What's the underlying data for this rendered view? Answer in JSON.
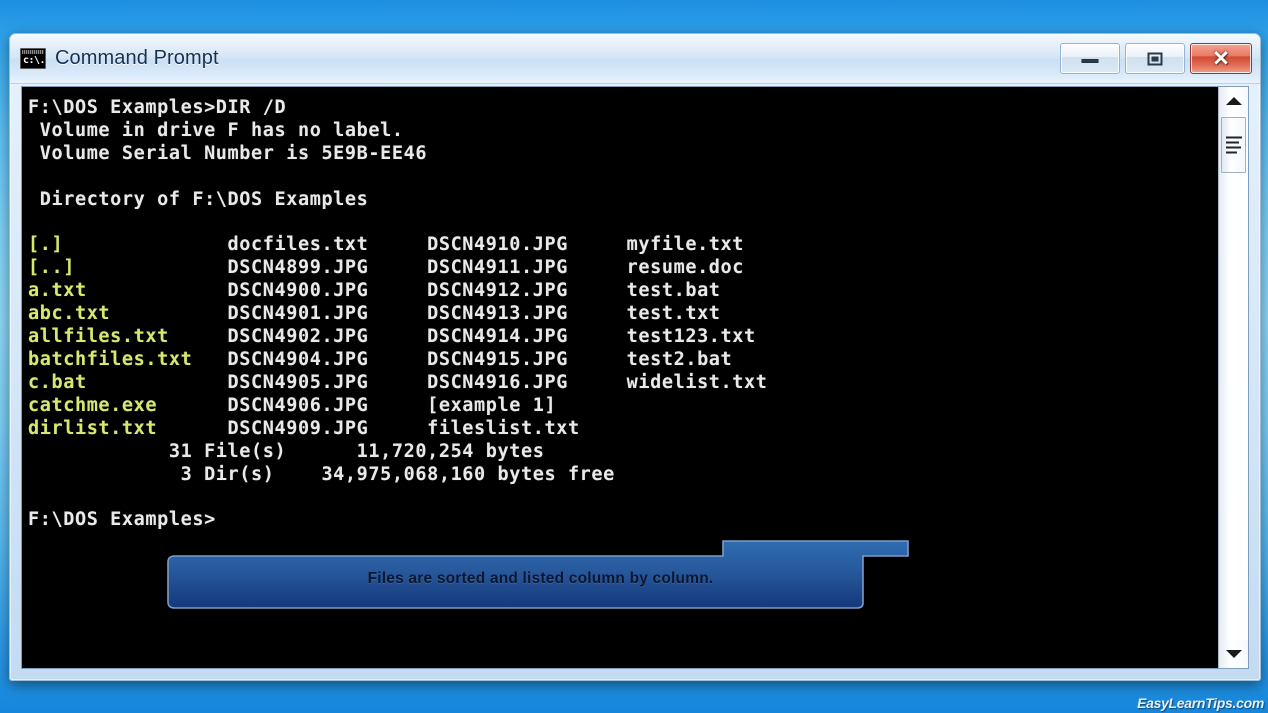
{
  "desktop": {
    "watermark": "EasyLearnTips.com"
  },
  "window": {
    "title": "Command Prompt",
    "icon": "command-prompt-icon",
    "icon_glyph": "c:\\.",
    "buttons": {
      "minimize": "Minimize",
      "maximize": "Maximize",
      "close": "Close",
      "close_glyph": "✕"
    }
  },
  "console": {
    "prompt_path": "F:\\DOS Examples>",
    "command": "DIR /D",
    "volume_label_line": " Volume in drive F has no label.",
    "volume_serial_line": " Volume Serial Number is 5E9B-EE46",
    "directory_of_line": " Directory of F:\\DOS Examples",
    "columns": [
      {
        "color": "#d9e86b",
        "entries": [
          "[.]",
          "[..]",
          "a.txt",
          "abc.txt",
          "allfiles.txt",
          "batchfiles.txt",
          "c.bat",
          "catchme.exe",
          "dirlist.txt"
        ]
      },
      {
        "color": "#e9e9e9",
        "entries": [
          "docfiles.txt",
          "DSCN4899.JPG",
          "DSCN4900.JPG",
          "DSCN4901.JPG",
          "DSCN4902.JPG",
          "DSCN4904.JPG",
          "DSCN4905.JPG",
          "DSCN4906.JPG",
          "DSCN4909.JPG"
        ]
      },
      {
        "color": "#e9e9e9",
        "entries": [
          "DSCN4910.JPG",
          "DSCN4911.JPG",
          "DSCN4912.JPG",
          "DSCN4913.JPG",
          "DSCN4914.JPG",
          "DSCN4915.JPG",
          "DSCN4916.JPG",
          "[example 1]",
          "fileslist.txt"
        ]
      },
      {
        "color": "#e9e9e9",
        "entries": [
          "myfile.txt",
          "resume.doc",
          "test.bat",
          "test.txt",
          "test123.txt",
          "test2.bat",
          "widelist.txt",
          "",
          ""
        ]
      }
    ],
    "summary": {
      "file_count": "31",
      "file_label": "File(s)",
      "file_bytes": "11,720,254",
      "bytes_label": "bytes",
      "dir_count": "3",
      "dir_label": "Dir(s)",
      "free_bytes": "34,975,068,160",
      "free_label": "bytes free"
    },
    "final_prompt": "F:\\DOS Examples>",
    "rendered_text": "F:\\DOS Examples>DIR /D\n Volume in drive F has no label.\n Volume Serial Number is 5E9B-EE46\n\n Directory of F:\\DOS Examples\n\n"
  },
  "callout": {
    "text": "Files are sorted and listed column by column.",
    "fill_top": "#2e6bb0",
    "fill_bottom": "#17407f",
    "border": "#7e9cc4"
  },
  "scrollbar": {
    "up_arrow": "scroll-up",
    "down_arrow": "scroll-down",
    "thumb": "scroll-thumb"
  }
}
